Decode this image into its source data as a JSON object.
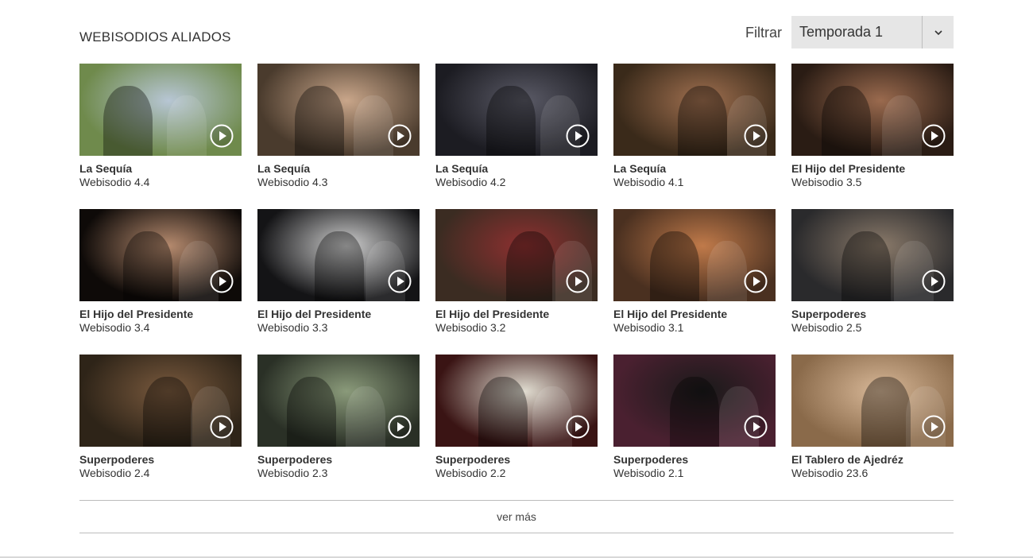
{
  "header": {
    "title": "WEBISODIOS ALIADOS",
    "filter_label": "Filtrar",
    "filter_value": "Temporada 1"
  },
  "episodes": [
    {
      "title": "La Sequía",
      "subtitle": "Webisodio 4.4",
      "thumb_bg": "#6f8a4c",
      "thumb_accent": "#b7c6d4"
    },
    {
      "title": "La Sequía",
      "subtitle": "Webisodio 4.3",
      "thumb_bg": "#4a3b2d",
      "thumb_accent": "#c9a68a"
    },
    {
      "title": "La Sequía",
      "subtitle": "Webisodio 4.2",
      "thumb_bg": "#1c1c22",
      "thumb_accent": "#5a5a66"
    },
    {
      "title": "La Sequía",
      "subtitle": "Webisodio 4.1",
      "thumb_bg": "#3a2a1a",
      "thumb_accent": "#a07050"
    },
    {
      "title": "El Hijo del Presidente",
      "subtitle": "Webisodio 3.5",
      "thumb_bg": "#2a1c14",
      "thumb_accent": "#9a6a4e"
    },
    {
      "title": "El Hijo del Presidente",
      "subtitle": "Webisodio 3.4",
      "thumb_bg": "#0e0a08",
      "thumb_accent": "#b58a6e"
    },
    {
      "title": "El Hijo del Presidente",
      "subtitle": "Webisodio 3.3",
      "thumb_bg": "#141416",
      "thumb_accent": "#cfcfcf"
    },
    {
      "title": "El Hijo del Presidente",
      "subtitle": "Webisodio 3.2",
      "thumb_bg": "#3b2c22",
      "thumb_accent": "#8e3030"
    },
    {
      "title": "El Hijo del Presidente",
      "subtitle": "Webisodio 3.1",
      "thumb_bg": "#4a3020",
      "thumb_accent": "#c07a4a"
    },
    {
      "title": "Superpoderes",
      "subtitle": "Webisodio 2.5",
      "thumb_bg": "#2a2a2c",
      "thumb_accent": "#8a7a6a"
    },
    {
      "title": "Superpoderes",
      "subtitle": "Webisodio 2.4",
      "thumb_bg": "#2e2418",
      "thumb_accent": "#7a5a3e"
    },
    {
      "title": "Superpoderes",
      "subtitle": "Webisodio 2.3",
      "thumb_bg": "#2a3026",
      "thumb_accent": "#8a9a7a"
    },
    {
      "title": "Superpoderes",
      "subtitle": "Webisodio 2.2",
      "thumb_bg": "#3a1414",
      "thumb_accent": "#e0dcd0"
    },
    {
      "title": "Superpoderes",
      "subtitle": "Webisodio 2.1",
      "thumb_bg": "#4a2030",
      "thumb_accent": "#1a1a1a"
    },
    {
      "title": "El Tablero de Ajedréz",
      "subtitle": "Webisodio 23.6",
      "thumb_bg": "#8a6a4a",
      "thumb_accent": "#d8b898"
    }
  ],
  "more": {
    "label": "ver más"
  },
  "icons": {
    "play": "play-circle-icon",
    "dropdown": "chevron-down-icon"
  }
}
